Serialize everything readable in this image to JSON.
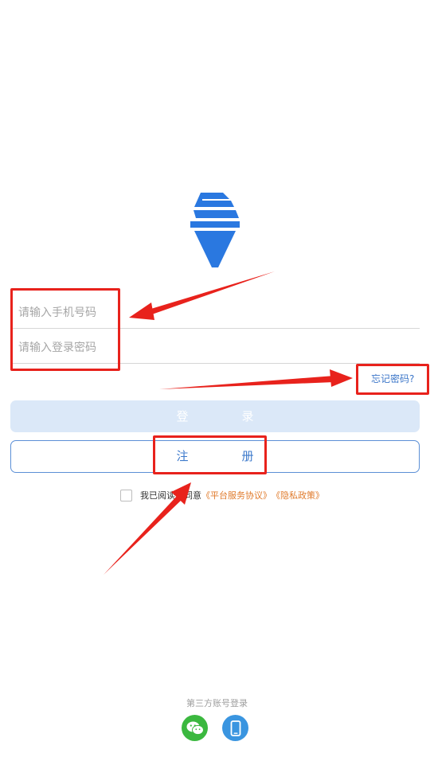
{
  "login_form": {
    "phone_placeholder": "请输入手机号码",
    "password_placeholder": "请输入登录密码",
    "forgot_password": "忘记密码?",
    "login_button": "登　录",
    "register_button": "注　册"
  },
  "agreement": {
    "prefix": "我已阅读并同意",
    "platform_link": "《平台服务协议》",
    "privacy_link": "《隐私政策》"
  },
  "third_party": {
    "title": "第三方账号登录",
    "icons": [
      "wechat-icon",
      "phone-icon"
    ]
  },
  "colors": {
    "primary": "#3f7bcc",
    "login_disabled": "#dbe8f8",
    "link_orange": "#e07b2c",
    "wechat": "#3bb83f",
    "phone": "#3a95e0",
    "annotation": "#e8221c"
  }
}
